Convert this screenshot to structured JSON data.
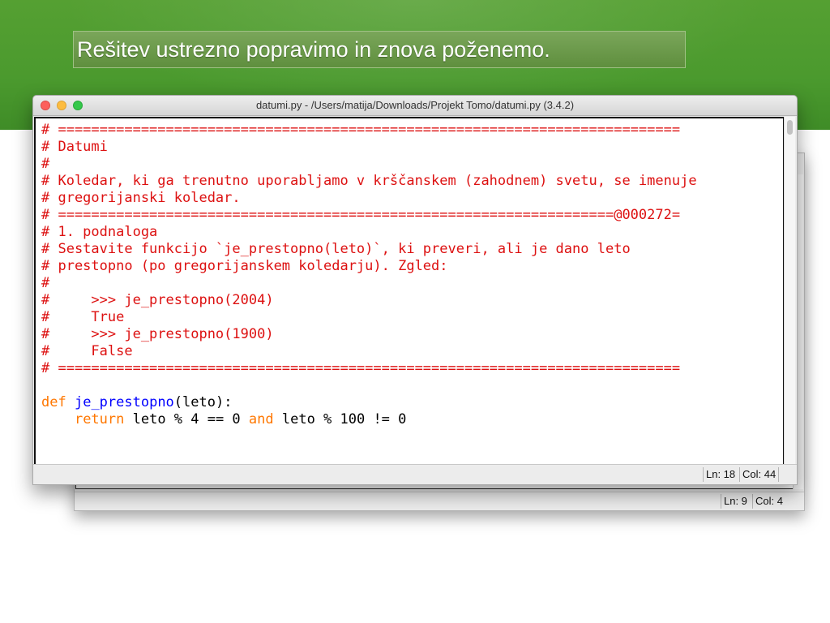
{
  "slide": {
    "title": "Rešitev ustrezno popravimo in znova poženemo."
  },
  "colors": {
    "banner_green": "#4b9a2e",
    "comment_red": "#dd1111",
    "keyword_orange": "#ff7700",
    "function_blue": "#0000ff"
  },
  "front_window": {
    "title": "datumi.py - /Users/matija/Downloads/Projekt Tomo/datumi.py (3.4.2)",
    "code_lines": [
      {
        "parts": [
          {
            "t": "c",
            "text": "# ==========================================================================="
          }
        ]
      },
      {
        "parts": [
          {
            "t": "c",
            "text": "# Datumi"
          }
        ]
      },
      {
        "parts": [
          {
            "t": "c",
            "text": "#"
          }
        ]
      },
      {
        "parts": [
          {
            "t": "c",
            "text": "# Koledar, ki ga trenutno uporabljamo v krščanskem (zahodnem) svetu, se imenuje"
          }
        ]
      },
      {
        "parts": [
          {
            "t": "c",
            "text": "# gregorijanski koledar."
          }
        ]
      },
      {
        "parts": [
          {
            "t": "c",
            "text": "# ===================================================================@000272="
          }
        ]
      },
      {
        "parts": [
          {
            "t": "c",
            "text": "# 1. podnaloga"
          }
        ]
      },
      {
        "parts": [
          {
            "t": "c",
            "text": "# Sestavite funkcijo `je_prestopno(leto)`, ki preveri, ali je dano leto"
          }
        ]
      },
      {
        "parts": [
          {
            "t": "c",
            "text": "# prestopno (po gregorijanskem koledarju). Zgled:"
          }
        ]
      },
      {
        "parts": [
          {
            "t": "c",
            "text": "#"
          }
        ]
      },
      {
        "parts": [
          {
            "t": "c",
            "text": "#     >>> je_prestopno(2004)"
          }
        ]
      },
      {
        "parts": [
          {
            "t": "c",
            "text": "#     True"
          }
        ]
      },
      {
        "parts": [
          {
            "t": "c",
            "text": "#     >>> je_prestopno(1900)"
          }
        ]
      },
      {
        "parts": [
          {
            "t": "c",
            "text": "#     False"
          }
        ]
      },
      {
        "parts": [
          {
            "t": "c",
            "text": "# ==========================================================================="
          }
        ]
      },
      {
        "parts": [
          {
            "t": "p",
            "text": ""
          }
        ]
      },
      {
        "parts": [
          {
            "t": "k",
            "text": "def"
          },
          {
            "t": "p",
            "text": " "
          },
          {
            "t": "f",
            "text": "je_prestopno"
          },
          {
            "t": "p",
            "text": "(leto):"
          }
        ]
      },
      {
        "parts": [
          {
            "t": "p",
            "text": "    "
          },
          {
            "t": "k",
            "text": "return"
          },
          {
            "t": "p",
            "text": " leto % 4 == 0 "
          },
          {
            "t": "k",
            "text": "and"
          },
          {
            "t": "p",
            "text": " leto % 100 != 0"
          }
        ]
      }
    ],
    "status": {
      "line": "Ln: 18",
      "col": "Col: 44"
    }
  },
  "back_window": {
    "status": {
      "line": "Ln: 9",
      "col": "Col: 4"
    }
  }
}
